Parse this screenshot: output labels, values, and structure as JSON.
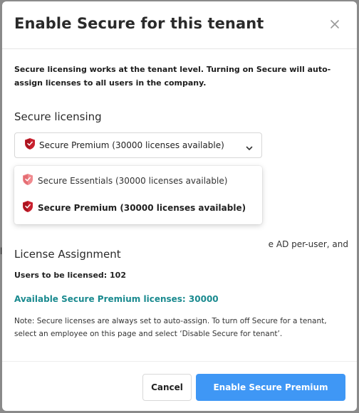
{
  "dialog": {
    "title": "Enable Secure for this tenant",
    "intro": "Secure licensing works at the tenant level. Turning on Secure will auto-assign licenses to all users in the company."
  },
  "licensing": {
    "heading": "Secure licensing",
    "selected": "Secure Premium (30000 licenses available)",
    "options": [
      {
        "label": "Secure Essentials (30000 licenses available)",
        "icon": "shield-essentials-icon",
        "color": "#f08a8f",
        "selected": false
      },
      {
        "label": "Secure Premium (30000 licenses available)",
        "icon": "shield-premium-icon",
        "color": "#c8202e",
        "selected": true
      }
    ]
  },
  "background": {
    "partial_text": "e AD per-user, and"
  },
  "assignment": {
    "heading": "License Assignment",
    "users": "Users to be licensed: 102",
    "available": "Available Secure Premium licenses: 30000",
    "note": "Note: Secure licenses are always set to auto-assign. To turn off Secure for a tenant, select an employee on this page and select ‘Disable Secure for tenant’."
  },
  "footer": {
    "cancel_label": "Cancel",
    "enable_label": "Enable Secure Premium"
  },
  "colors": {
    "accent": "#3f97f5",
    "available_text": "#1a8a8f",
    "premium_shield": "#c8202e",
    "essentials_shield": "#f08a8f"
  }
}
